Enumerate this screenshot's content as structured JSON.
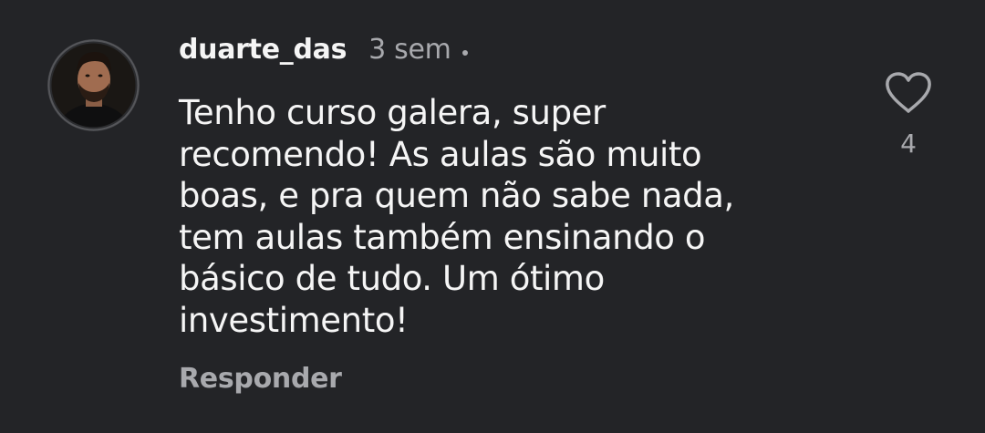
{
  "comment": {
    "author": {
      "username": "duarte_das",
      "avatar": "user-avatar"
    },
    "time": "3 sem",
    "text_lines": [
      "Tenho curso galera, super",
      "recomendo! As aulas são muito",
      "boas, e pra quem não sabe nada,",
      "tem aulas também ensinando o",
      "básico de tudo. Um ótimo",
      "investimento!"
    ],
    "reply_label": "Responder",
    "like": {
      "icon": "heart-outline-icon",
      "count": "4"
    }
  },
  "colors": {
    "background": "#232427",
    "text_primary": "#f5f5f5",
    "text_secondary": "#a8a9ad"
  }
}
